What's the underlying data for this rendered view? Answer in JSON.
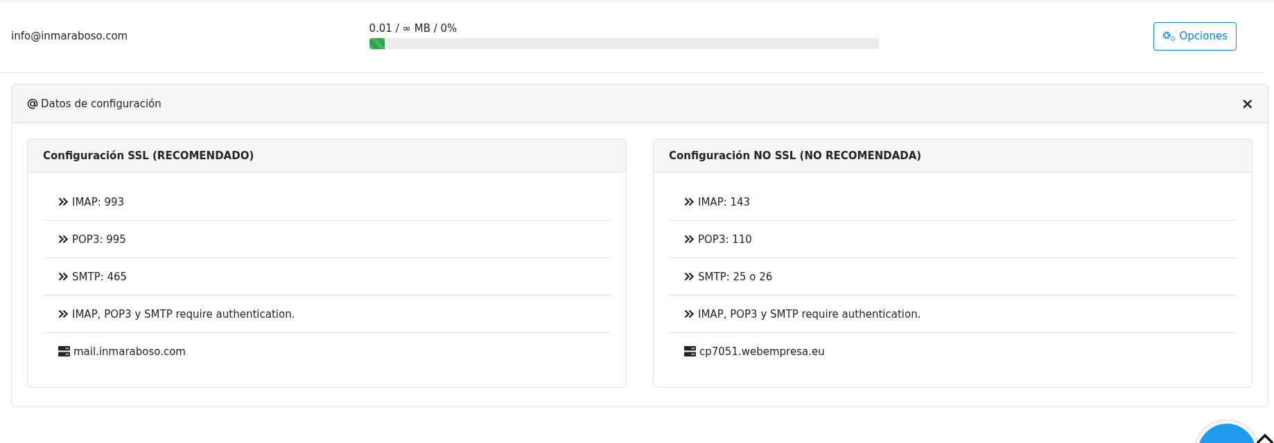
{
  "account": {
    "email": "info@inmaraboso.com",
    "usage": "0.01 / ∞ MB / 0%",
    "level": 0.03,
    "options_button": "Opciones"
  },
  "config_panel": {
    "title": "Datos de configuración",
    "close": "×",
    "cards": [
      {
        "title": "Configuración SSL (RECOMENDADO)",
        "items": [
          {
            "kind": "port",
            "text": "IMAP: 993"
          },
          {
            "kind": "port",
            "text": "POP3: 995"
          },
          {
            "kind": "port",
            "text": "SMTP: 465"
          },
          {
            "kind": "port",
            "text": "IMAP, POP3 y SMTP require authentication."
          },
          {
            "kind": "host",
            "text": "mail.inmaraboso.com"
          }
        ]
      },
      {
        "title": "Configuración NO SSL (NO RECOMENDADA)",
        "items": [
          {
            "kind": "port",
            "text": "IMAP: 143"
          },
          {
            "kind": "port",
            "text": "POP3: 110"
          },
          {
            "kind": "port",
            "text": "SMTP: 25 o 26"
          },
          {
            "kind": "port",
            "text": "IMAP, POP3 y SMTP require authentication."
          },
          {
            "kind": "host",
            "text": "cp7051.webempresa.eu"
          }
        ]
      }
    ]
  }
}
